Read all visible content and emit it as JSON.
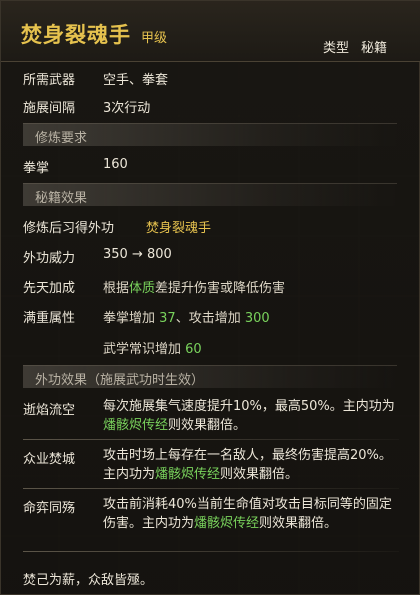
{
  "header": {
    "title": "焚身裂魂手",
    "grade": "甲级",
    "type_label": "类型",
    "type_value": "秘籍"
  },
  "basic": {
    "weapon_label": "所需武器",
    "weapon_value": "空手、拳套",
    "interval_label": "施展间隔",
    "interval_value": "3次行动"
  },
  "requirements": {
    "section_title": "修炼要求",
    "fist_label": "拳掌",
    "fist_value": "160"
  },
  "book_effects": {
    "section_title": "秘籍效果",
    "learn_label": "修炼后习得外功",
    "learn_value": "焚身裂魂手",
    "power_label": "外功威力",
    "power_value": "350 → 800",
    "innate_label": "先天加成",
    "innate_prefix": "根据",
    "innate_highlight": "体质",
    "innate_suffix": "差提升伤害或降低伤害",
    "full_label": "满重属性",
    "full_line1_a": "拳掌增加 ",
    "full_line1_v1": "37",
    "full_line1_b": "、攻击增加 ",
    "full_line1_v2": "300",
    "full_line2_a": "武学常识增加 ",
    "full_line2_v": "60"
  },
  "skill_effects": {
    "section_title": "外功效果（施展武功时生效）",
    "items": [
      {
        "label": "逝焰流空",
        "text_a": "每次施展集气速度提升10%，最高50%。主内功为",
        "highlight": "燔骸烬传经",
        "text_b": "则效果翻倍。"
      },
      {
        "label": "众业焚城",
        "text_a": "攻击时场上每存在一名敌人，最终伤害提高20%。主内功为",
        "highlight": "燔骸烬传经",
        "text_b": "则效果翻倍。"
      },
      {
        "label": "命弈同殇",
        "text_a": "攻击前消耗40%当前生命值对攻击目标同等的固定伤害。主内功为",
        "highlight": "燔骸烬传经",
        "text_b": "则效果翻倍。"
      }
    ]
  },
  "flavor": {
    "quote": "焚己为薪，众敌皆殛。"
  },
  "colors": {
    "accent_yellow": "#e6c24e",
    "accent_green": "#79d25c",
    "text": "#ece6d8"
  }
}
